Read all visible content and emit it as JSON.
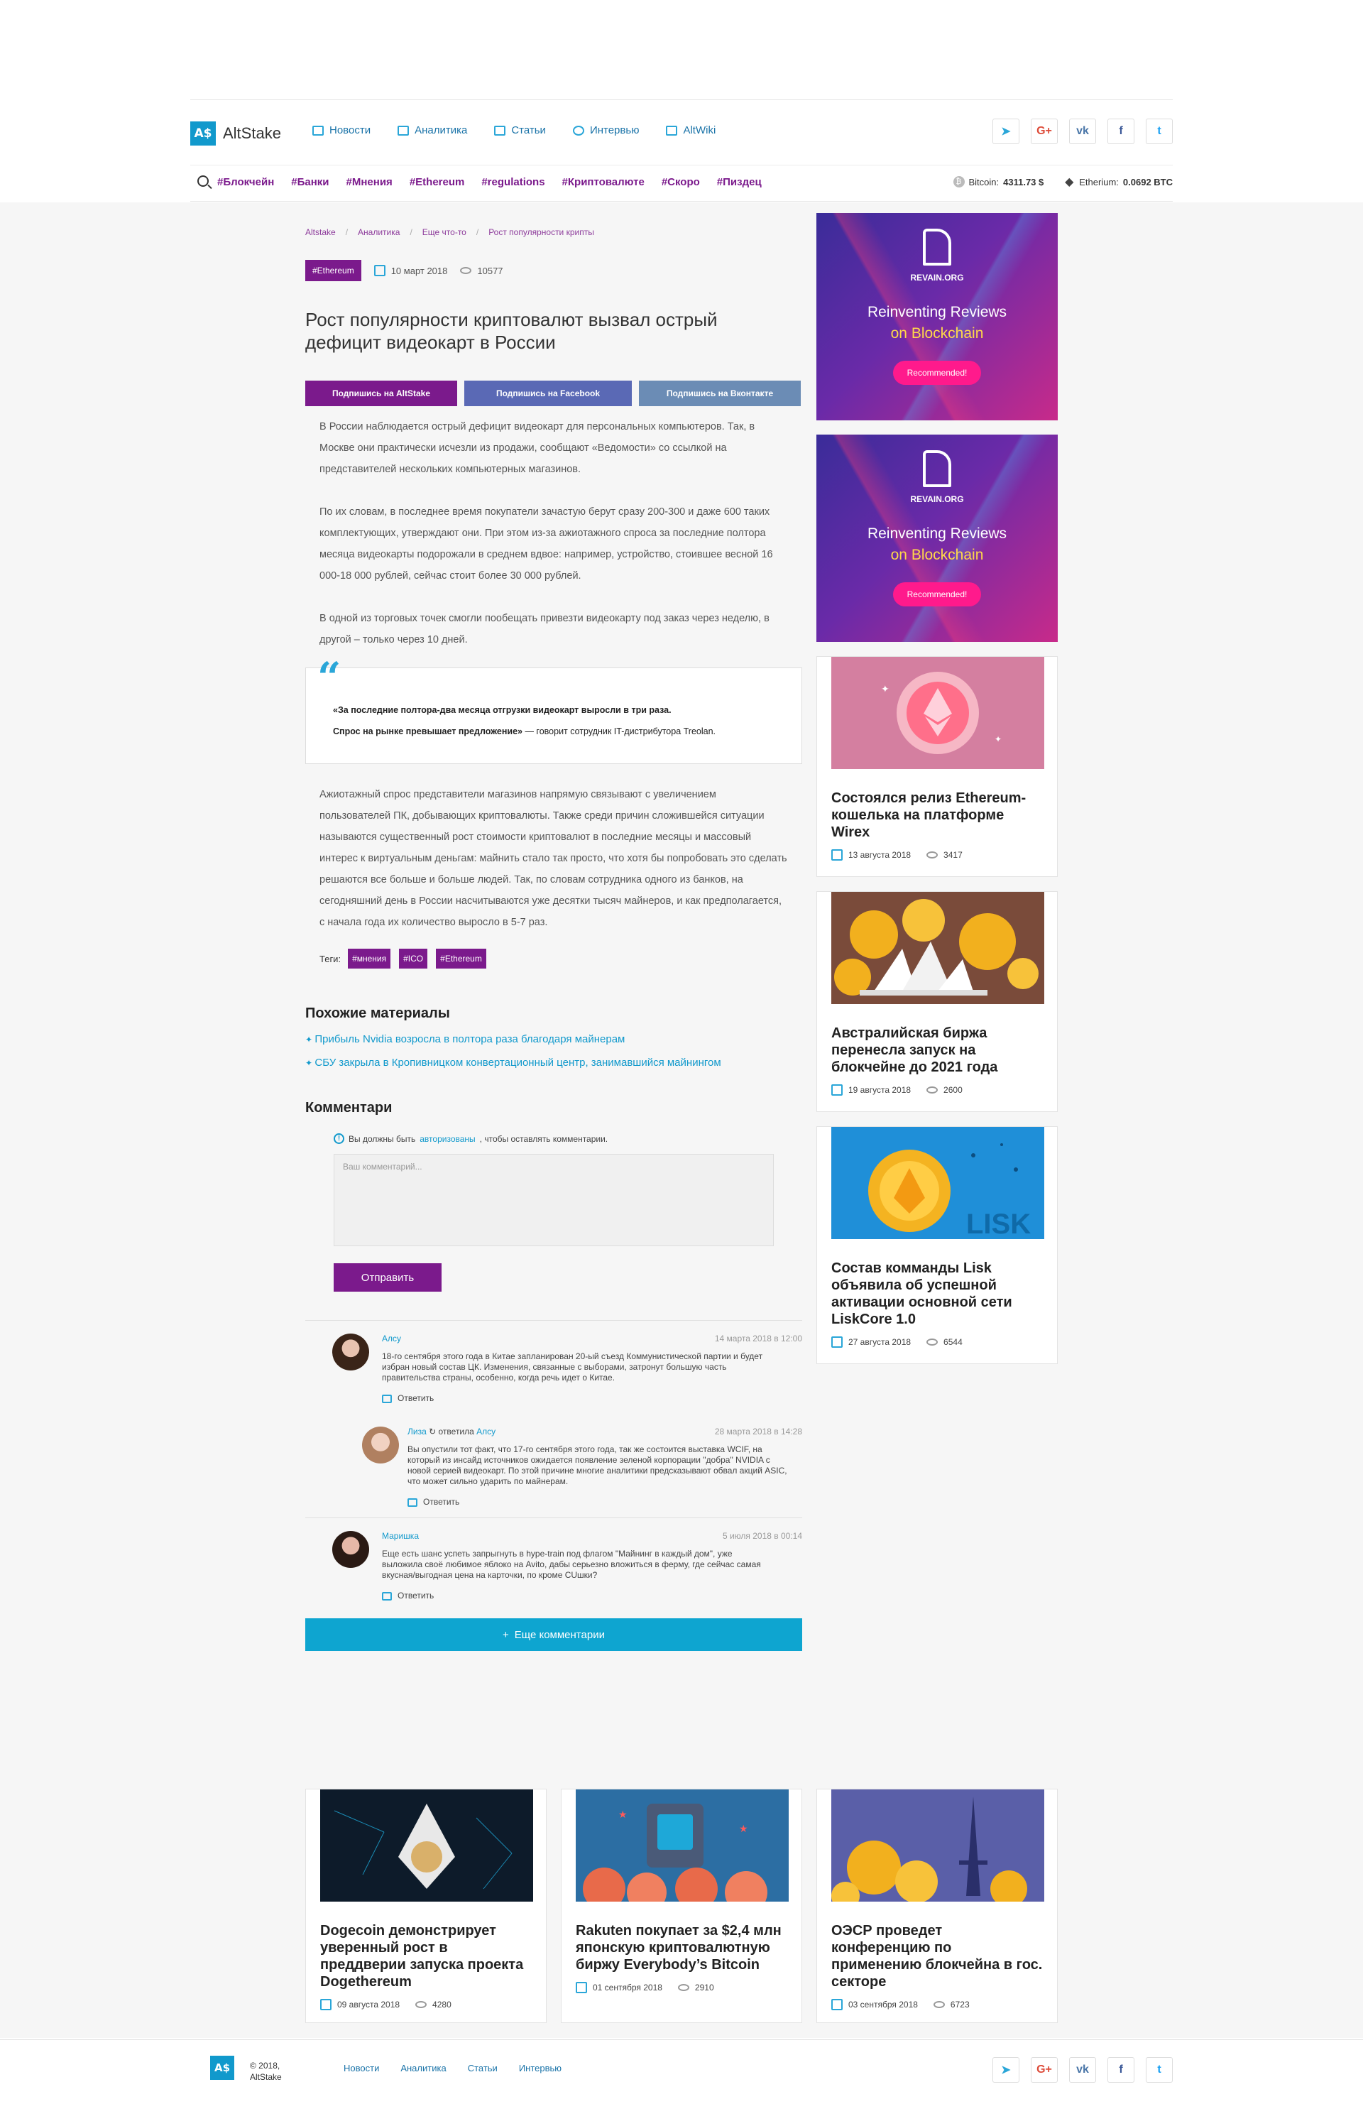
{
  "header": {
    "logo_mark": "A$",
    "logo_text": "AltStake",
    "nav": [
      {
        "label": "Новости",
        "icon": "newspaper-icon"
      },
      {
        "label": "Аналитика",
        "icon": "chart-icon"
      },
      {
        "label": "Статьи",
        "icon": "list-icon"
      },
      {
        "label": "Интервью",
        "icon": "person-icon"
      },
      {
        "label": "AltWiki",
        "icon": "wiki-icon"
      }
    ],
    "socials": [
      {
        "label": "➤",
        "name": "telegram-icon"
      },
      {
        "label": "G+",
        "name": "google-plus-icon"
      },
      {
        "label": "vk",
        "name": "vk-icon"
      },
      {
        "label": "f",
        "name": "facebook-icon"
      },
      {
        "label": "t",
        "name": "twitter-icon"
      }
    ],
    "tags": [
      "#Блокчейн",
      "#Банки",
      "#Мнения",
      "#Ethereum",
      "#regulations",
      "#Криптовалюте",
      "#Скоро",
      "#Пиздец"
    ],
    "rates": {
      "btc_label": "Bitcoin:",
      "btc_value": "4311.73 $",
      "eth_label": "Etherium:",
      "eth_value": "0.0692 BTC"
    }
  },
  "article": {
    "breadcrumb": [
      "Altstake",
      "Аналитика",
      "Еще что-то",
      "Рост популярности крипты"
    ],
    "tag": "#Ethereum",
    "date": "10 март 2018",
    "views": "10577",
    "title": "Рост популярности криптовалют вызвал острый дефицит видеокарт в России",
    "sub_buttons": [
      "Подпишись на AltStake",
      "Подпишись на Facebook",
      "Подпишись на Вконтакте"
    ],
    "paragraphs": [
      "В России наблюдается острый дефицит видеокарт для персональных компьютеров. Так, в Москве они практически исчезли из продажи, сообщают «Ведомости» со ссылкой на представителей нескольких компьютерных магазинов.",
      "По их словам, в последнее время покупатели зачастую берут сразу 200-300 и даже 600 таких комплектующих, утверждают они. При этом из-за ажиотажного спроса за последние полтора месяца видеокарты подорожали в среднем вдвое: например, устройство, стоившее весной 16 000-18 000 рублей, сейчас стоит более 30 000 рублей.",
      "В одной из торговых точек смогли пообещать привезти видеокарту под заказ через неделю, в другой – только через 10 дней."
    ],
    "quote_mark": "“",
    "quote_line1": "«За последние полтора-два месяца отгрузки видеокарт выросли в три раза.",
    "quote_line2_bold": "Спрос на рынке превышает предложение»",
    "quote_line2_rest": " — говорит сотрудник IT-дистрибутора Treolan.",
    "paragraph_after": "Ажиотажный спрос представители магазинов напрямую связывают с увеличением пользователей ПК, добывающих криптовалюты. Также среди причин сложившейся ситуации называются существенный рост стоимости криптовалют в последние месяцы и массовый интерес к виртуальным деньгам: майнить стало так просто, что хотя бы попробовать это сделать решаются все больше и больше людей. Так, по словам сотрудника одного из банков, на сегодняшний день в России насчитываются уже десятки тысяч майнеров, и как предполагается, с начала года их количество выросло в 5-7 раз.",
    "tags_label": "Теги:",
    "tags": [
      "#мнения",
      "#ICO",
      "#Ethereum"
    ]
  },
  "similar": {
    "title": "Похожие материалы",
    "items": [
      "Прибыль Nvidia возросла в полтора раза благодаря майнерам",
      "СБУ закрыла в Кропивницком конвертационный центр, занимавшийся майнингом"
    ]
  },
  "comments": {
    "title": "Комментари",
    "auth_prefix": "Вы должны быть ",
    "auth_link": "авторизованы",
    "auth_suffix": ", чтобы оставлять комментарии.",
    "placeholder": "Ваш комментарий...",
    "send": "Отправить",
    "reply_label": "Ответить",
    "items": [
      {
        "author": "Алсу",
        "date": "14 марта 2018 в 12:00",
        "text": "18-го сентября этого года в Китае запланирован 20-ый съезд Коммунистической партии и будет избран новый состав ЦК. Изменения, связанные с выборами, затронут большую часть правительства страны, особенно, когда речь идет о Китае."
      },
      {
        "author": "Лиза",
        "replied_word": "ответила",
        "replied_to": "Алсу",
        "date": "28 марта 2018 в 14:28",
        "text": "Вы опустили тот факт, что 17-го сентября этого года, так же состоится выставка WCIF, на который из инсайд источников ожидается появление зеленой корпорации \"добра\" NVIDIA с новой серией видеокарт. По этой причине многие аналитики предсказывают обвал акций ASIC, что может сильно ударить по майнерам."
      },
      {
        "author": "Маришка",
        "date": "5 июля 2018 в 00:14",
        "text": "Еще есть шанс успеть запрыгнуть в hype-train под флагом \"Майнинг в каждый дом\", уже выложила своё любимое яблоко на Avito, дабы серьезно вложиться в ферму, где сейчас самая вкусная/выгодная цена на карточки, по кроме CUшки?"
      }
    ],
    "more": "Еще комментарии"
  },
  "sidebar": {
    "banners": [
      {
        "org": "REVAIN.ORG",
        "line1": "Reinventing Reviews",
        "line2": "on Blockchain",
        "button": "Recommended!"
      },
      {
        "org": "REVAIN.ORG",
        "line1": "Reinventing Reviews",
        "line2": "on Blockchain",
        "button": "Recommended!"
      }
    ],
    "cards": [
      {
        "title": "Состоялся релиз Ethereum-кошелька на платформе Wirex",
        "date": "13 августа 2018",
        "views": "3417"
      },
      {
        "title": "Австралийская биржа перенесла запуск на блокчейне до 2021 года",
        "date": "19 августа 2018",
        "views": "2600"
      },
      {
        "title": "Состав комманды Lisk объявила об успешной активации основной сети LiskCore 1.0",
        "date": "27 августа 2018",
        "views": "6544"
      }
    ]
  },
  "bottom_cards": [
    {
      "title": "Dogecoin демонстрирует уверенный рост в преддверии запуска проекта Dogethereum",
      "date": "09 августа 2018",
      "views": "4280"
    },
    {
      "title": "Rakuten покупает за $2,4 млн японскую криптовалютную биржу Everybody’s Bitcoin",
      "date": "01 сентября 2018",
      "views": "2910"
    },
    {
      "title": "ОЭСР проведет конференцию по применению блокчейна в гос. секторе",
      "date": "03 сентября 2018",
      "views": "6723"
    }
  ],
  "footer": {
    "logo_mark": "A$",
    "copy1": "© 2018,",
    "copy2": "AltStake",
    "nav": [
      "Новости",
      "Аналитика",
      "Статьи",
      "Интервью"
    ]
  }
}
